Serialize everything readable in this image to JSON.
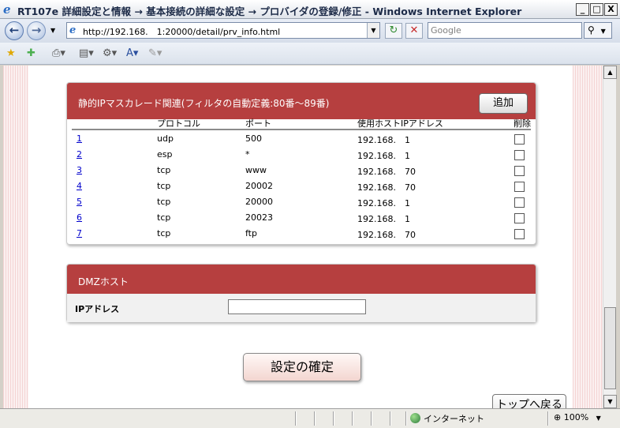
{
  "window": {
    "title": "RT107e 詳細設定と情報 → 基本接続の詳細な設定 → プロバイダの登録/修正 - Windows Internet Explorer",
    "minimize_glyph": "_",
    "maximize_glyph": "□",
    "close_glyph": "X"
  },
  "address_bar": {
    "url": "http://192.168.　1:20000/detail/prv_info.html",
    "search_placeholder": "Google"
  },
  "masquerade_panel": {
    "title": "静的IPマスカレード関連(フィルタの自動定義:80番〜89番)",
    "add_button": "追加",
    "columns": [
      "プロトコル",
      "ポート",
      "使用ホストIPアドレス",
      "削除"
    ],
    "rows": [
      {
        "num": "1",
        "protocol": "udp",
        "port": "500",
        "host": "192.168.　1"
      },
      {
        "num": "2",
        "protocol": "esp",
        "port": "*",
        "host": "192.168.　1"
      },
      {
        "num": "3",
        "protocol": "tcp",
        "port": "www",
        "host": "192.168.　70"
      },
      {
        "num": "4",
        "protocol": "tcp",
        "port": "20002",
        "host": "192.168.　70"
      },
      {
        "num": "5",
        "protocol": "tcp",
        "port": "20000",
        "host": "192.168.　1"
      },
      {
        "num": "6",
        "protocol": "tcp",
        "port": "20023",
        "host": "192.168.　1"
      },
      {
        "num": "7",
        "protocol": "tcp",
        "port": "ftp",
        "host": "192.168.　70"
      }
    ]
  },
  "dmz_panel": {
    "title": "DMZホスト",
    "ip_label": "IPアドレス",
    "ip_value": ""
  },
  "buttons": {
    "confirm": "設定の確定",
    "back_to_top": "トップへ戻る"
  },
  "status_bar": {
    "zone": "インターネット",
    "zoom": "100%"
  },
  "colors": {
    "panel_header": "#b63f3f",
    "link": "#0000cc"
  }
}
